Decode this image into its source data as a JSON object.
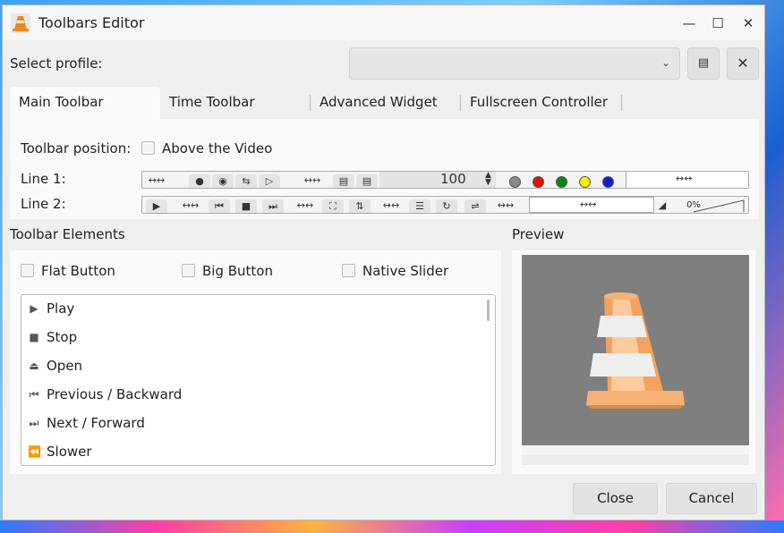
{
  "window": {
    "title": "Toolbars Editor"
  },
  "profile": {
    "label": "Select profile:",
    "value": ""
  },
  "tabs": [
    {
      "label": "Main Toolbar"
    },
    {
      "label": "Time Toolbar"
    },
    {
      "label": "Advanced Widget"
    },
    {
      "label": "Fullscreen Controller"
    }
  ],
  "main_toolbar": {
    "position_label": "Toolbar position:",
    "above_video_label": "Above the Video",
    "line1_label": "Line 1:",
    "line2_label": "Line 2:",
    "volume_value": "100",
    "volume_percent": "0%",
    "line1_dot_colors": [
      "#888888",
      "#e01010",
      "#0a8a0a",
      "#f0f000",
      "#1020d0"
    ]
  },
  "elements": {
    "title": "Toolbar Elements",
    "flat_button_label": "Flat Button",
    "big_button_label": "Big Button",
    "native_slider_label": "Native Slider",
    "items": [
      {
        "label": "Play",
        "icon": "play-icon"
      },
      {
        "label": "Stop",
        "icon": "stop-icon"
      },
      {
        "label": "Open",
        "icon": "eject-icon"
      },
      {
        "label": "Previous / Backward",
        "icon": "previous-icon"
      },
      {
        "label": "Next / Forward",
        "icon": "next-icon"
      },
      {
        "label": "Slower",
        "icon": "slower-icon"
      }
    ]
  },
  "preview": {
    "title": "Preview"
  },
  "buttons": {
    "close": "Close",
    "cancel": "Cancel"
  }
}
